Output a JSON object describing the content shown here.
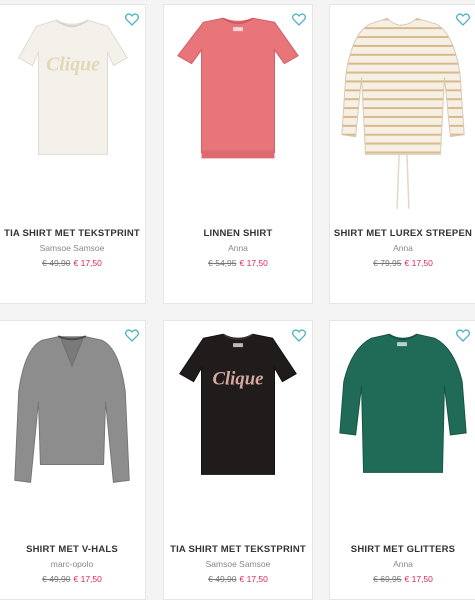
{
  "colors": {
    "accent_heart": "#4db3c4",
    "sale_price": "#e0245e"
  },
  "products": [
    {
      "name": "TIA SHIRT MET TEKSTPRINT",
      "brand": "Samsoe Samsoe",
      "old_price": "€ 49,90",
      "new_price": "€ 17,50",
      "icon": "heart-icon"
    },
    {
      "name": "LINNEN SHIRT",
      "brand": "Anna",
      "old_price": "€ 54,95",
      "new_price": "€ 17,50",
      "icon": "heart-icon"
    },
    {
      "name": "SHIRT MET LUREX STREPEN",
      "brand": "Anna",
      "old_price": "€ 79,95",
      "new_price": "€ 17,50",
      "icon": "heart-icon"
    },
    {
      "name": "SHIRT MET V-HALS",
      "brand": "marc-opolo",
      "old_price": "€ 49,90",
      "new_price": "€ 17,50",
      "icon": "heart-icon"
    },
    {
      "name": "TIA SHIRT MET TEKSTPRINT",
      "brand": "Samsoe Samsoe",
      "old_price": "€ 49,90",
      "new_price": "€ 17,50",
      "icon": "heart-icon"
    },
    {
      "name": "SHIRT MET GLITTERS",
      "brand": "Anna",
      "old_price": "€ 69,95",
      "new_price": "€ 17,50",
      "icon": "heart-icon"
    }
  ],
  "shirt_print": "Clique"
}
